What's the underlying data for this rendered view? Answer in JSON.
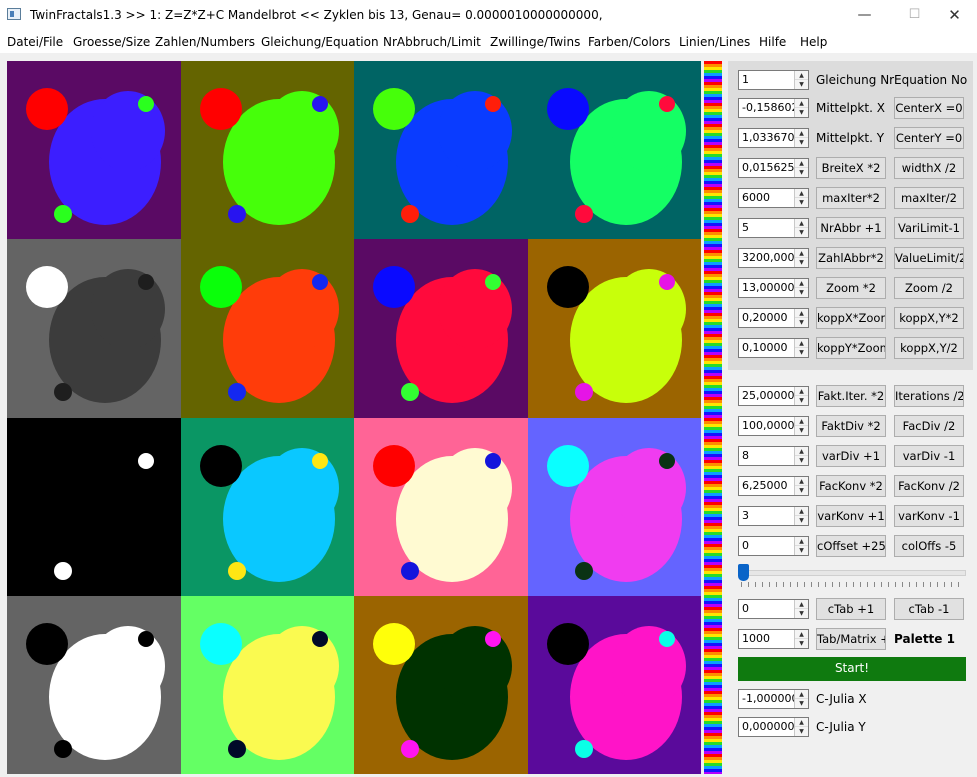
{
  "window": {
    "title": "TwinFractals1.3 >> 1: Z=Z*Z+C Mandelbrot << Zyklen bis 13, Genau= 0.0000010000000000,",
    "minimize": "—",
    "maximize": "☐",
    "close": "✕"
  },
  "menu": [
    "Datei/File",
    "Groesse/Size",
    "Zahlen/Numbers",
    "Gleichung/Equation",
    "NrAbbruch/Limit",
    "Zwillinge/Twins",
    "Farben/Colors",
    "Linien/Lines",
    "Hilfe",
    "Help"
  ],
  "panel": {
    "rows": [
      {
        "value": "1",
        "mid": "Gleichung Nr",
        "right": "Equation No"
      },
      {
        "value": "-0,158602(",
        "mid": "Mittelpkt. X",
        "right": "CenterX =0"
      },
      {
        "value": "1,0336700",
        "mid": "Mittelpkt. Y",
        "right": "CenterY =0"
      },
      {
        "value": "0,0156250",
        "mid": "BreiteX *2",
        "right": "widthX /2"
      },
      {
        "value": "6000",
        "mid": "maxIter*2",
        "right": "maxIter/2"
      },
      {
        "value": "5",
        "mid": "NrAbbr +1",
        "right": "VariLimit-1"
      },
      {
        "value": "3200,0000",
        "mid": "ZahlAbbr*2",
        "right": "ValueLimit/2"
      },
      {
        "value": "13,000000",
        "mid": "Zoom *2",
        "right": "Zoom /2"
      },
      {
        "value": "0,20000",
        "mid": "koppX*Zoom",
        "right": "koppX,Y*2"
      },
      {
        "value": "0,10000",
        "mid": "koppY*Zoom",
        "right": "koppX,Y/2"
      }
    ]
  },
  "controls": {
    "rows": [
      {
        "value": "25,00000",
        "mid": "Fakt.Iter. *2",
        "right": "Iterations /2"
      },
      {
        "value": "100,00000",
        "mid": "FaktDiv *2",
        "right": "FacDiv /2"
      },
      {
        "value": "8",
        "mid": "varDiv +1",
        "right": "varDiv -1"
      },
      {
        "value": "6,25000",
        "mid": "FacKonv *2",
        "right": "FacKonv /2"
      },
      {
        "value": "3",
        "mid": "varKonv +1",
        "right": "varKonv -1"
      },
      {
        "value": "0",
        "mid": "cOffset +25",
        "right": "colOffs -5"
      }
    ],
    "ctab": {
      "value": "0",
      "mid": "cTab +1",
      "right": "cTab -1"
    },
    "matrix": {
      "value": "1000",
      "mid": "Tab/Matrix +",
      "right": "Palette 1"
    },
    "start": "Start!",
    "julia_x": {
      "value": "-1,000000(",
      "label": "C-Julia X"
    },
    "julia_y": {
      "value": "0,0000000(",
      "label": "C-Julia Y"
    },
    "slider_value": 0
  },
  "tiles": [
    {
      "bg": "#5a0a64",
      "main": "#3c1eff",
      "small_tl": "#ff0000",
      "small_tr": "#2aff1e",
      "small_bl": "#2aff1e"
    },
    {
      "bg": "#646400",
      "main": "#46ff0a",
      "small_tl": "#ff0000",
      "small_tr": "#2814f0",
      "small_bl": "#2814f0"
    },
    {
      "bg": "#006464",
      "main": "#0a3cff",
      "small_tl": "#46ff0a",
      "small_tr": "#ff1e0a",
      "small_bl": "#ff1e0a"
    },
    {
      "bg": "#006464",
      "main": "#14ff64",
      "small_tl": "#0a0aff",
      "small_tr": "#ff0a3c",
      "small_bl": "#ff0a3c"
    },
    {
      "bg": "#646464",
      "main": "#3c3c3c",
      "small_tl": "#ffffff",
      "small_tr": "#1e1e1e",
      "small_bl": "#1e1e1e"
    },
    {
      "bg": "#646400",
      "main": "#ff3c0a",
      "small_tl": "#0aff0a",
      "small_tr": "#1428f0",
      "small_bl": "#1428f0"
    },
    {
      "bg": "#5a0a64",
      "main": "#ff0a3c",
      "small_tl": "#0a0aff",
      "small_tr": "#32ff32",
      "small_bl": "#32ff32"
    },
    {
      "bg": "#9b6400",
      "main": "#c8ff0a",
      "small_tl": "#000000",
      "small_tr": "#e614e6",
      "small_bl": "#e614e6"
    },
    {
      "bg": "#000000",
      "main": "#000000",
      "small_tl": "#000000",
      "small_tr": "#ffffff",
      "small_bl": "#ffffff"
    },
    {
      "bg": "#0a9664",
      "main": "#0ac8ff",
      "small_tl": "#000000",
      "small_tr": "#ffe614",
      "small_bl": "#ffe614"
    },
    {
      "bg": "#ff6496",
      "main": "#fffad2",
      "small_tl": "#ff0000",
      "small_tr": "#1414dc",
      "small_bl": "#1414dc"
    },
    {
      "bg": "#6464ff",
      "main": "#f03cf0",
      "small_tl": "#0affff",
      "small_tr": "#0a3214",
      "small_bl": "#0a3214"
    },
    {
      "bg": "#646464",
      "main": "#ffffff",
      "small_tl": "#000000",
      "small_tr": "#000000",
      "small_bl": "#000000"
    },
    {
      "bg": "#64ff64",
      "main": "#fafa50",
      "small_tl": "#0affff",
      "small_tr": "#000a28",
      "small_bl": "#000a28"
    },
    {
      "bg": "#9b6400",
      "main": "#003200",
      "small_tl": "#ffff0a",
      "small_tr": "#ff14f0",
      "small_bl": "#ff14f0"
    },
    {
      "bg": "#5a0a9b",
      "main": "#ff14c8",
      "small_tl": "#000000",
      "small_tr": "#0affe6",
      "small_bl": "#0affe6"
    }
  ],
  "stripe_colors": [
    "#ff0000",
    "#ff8c00",
    "#ffe600",
    "#28dc28",
    "#0aa0ff",
    "#1414ff",
    "#b400ff"
  ]
}
